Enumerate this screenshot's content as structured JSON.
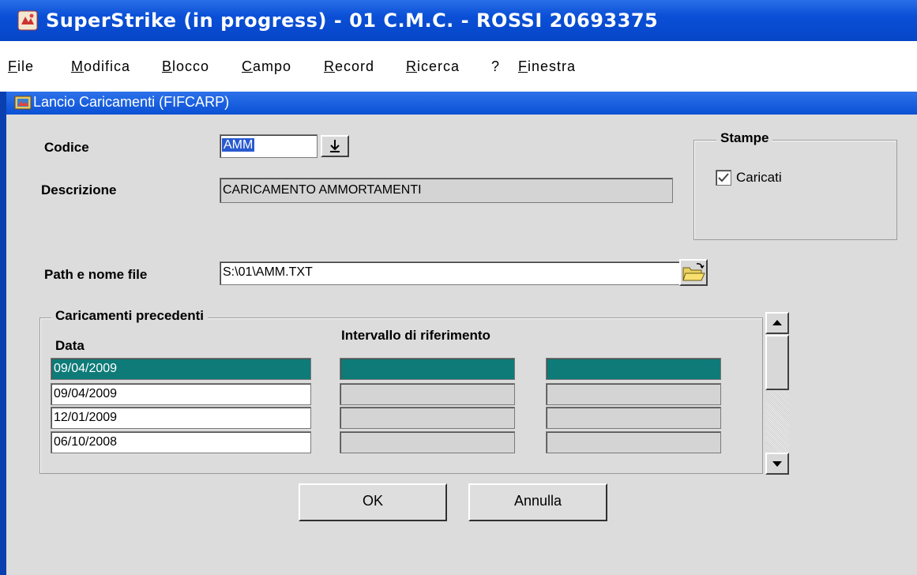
{
  "window": {
    "title": "SuperStrike (in progress) - 01 C.M.C. - ROSSI 20693375"
  },
  "menu": [
    {
      "label": "File",
      "accel": "F",
      "rest": "ile"
    },
    {
      "label": "Modifica",
      "accel": "M",
      "rest": "odifica"
    },
    {
      "label": "Blocco",
      "accel": "B",
      "rest": "locco"
    },
    {
      "label": "Campo",
      "accel": "C",
      "rest": "ampo"
    },
    {
      "label": "Record",
      "accel": "R",
      "rest": "ecord"
    },
    {
      "label": "Ricerca",
      "accel": "R",
      "rest": "icerca"
    },
    {
      "label": "?",
      "accel": "",
      "rest": "?"
    },
    {
      "label": "Finestra",
      "accel": "F",
      "rest": "inestra"
    }
  ],
  "form": {
    "title": "Lancio Caricamenti (FIFCARP)",
    "codice_label": "Codice",
    "codice_value": "AMM",
    "descrizione_label": "Descrizione",
    "descrizione_value": "CARICAMENTO AMMORTAMENTI",
    "path_label": "Path e nome file",
    "path_value": "S:\\01\\AMM.TXT"
  },
  "stampe": {
    "title": "Stampe",
    "caricati_label": "Caricati",
    "caricati_checked": true
  },
  "precedenti": {
    "title": "Caricamenti precedenti",
    "col_data": "Data",
    "col_intervallo": "Intervallo di riferimento",
    "rows": [
      {
        "data": "09/04/2009",
        "from": "",
        "to": "",
        "selected": true
      },
      {
        "data": "09/04/2009",
        "from": "",
        "to": "",
        "selected": false
      },
      {
        "data": "12/01/2009",
        "from": "",
        "to": "",
        "selected": false
      },
      {
        "data": "06/10/2008",
        "from": "",
        "to": "",
        "selected": false
      }
    ]
  },
  "buttons": {
    "ok": "OK",
    "annulla": "Annulla"
  },
  "colors": {
    "titlebar": "#0a4fd6",
    "selection": "#0e7b78",
    "panel": "#dcdcdc"
  }
}
